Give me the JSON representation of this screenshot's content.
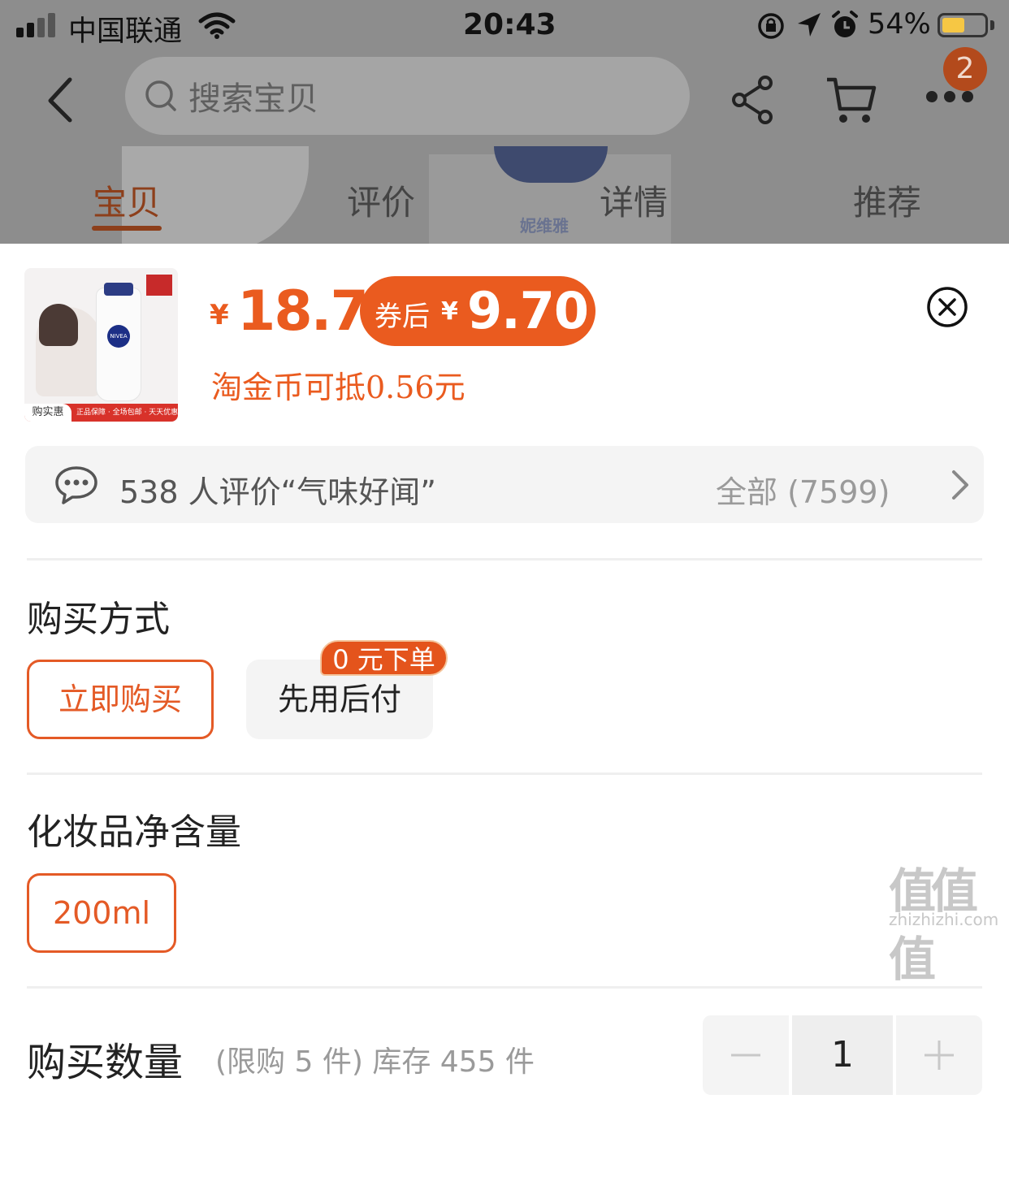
{
  "status_bar": {
    "carrier": "中国联通",
    "time": "20:43",
    "battery_percent": "54%",
    "battery_level": 0.54
  },
  "header": {
    "search_placeholder": "搜索宝贝",
    "message_badge": "2",
    "icons": [
      "back-icon",
      "search-icon",
      "share-icon",
      "cart-icon",
      "more-icon"
    ]
  },
  "background": {
    "brand_text": "妮维雅"
  },
  "tabs": [
    {
      "label": "宝贝",
      "active": true
    },
    {
      "label": "评价",
      "active": false
    },
    {
      "label": "详情",
      "active": false
    },
    {
      "label": "推荐",
      "active": false
    }
  ],
  "product": {
    "thumb_logo": "NIVEA",
    "thumb_footer_badge": "购实惠",
    "thumb_footer_text": "正品保障 · 全场包邮 · 天天优惠",
    "price_currency": "¥",
    "price": "18.7",
    "coupon_label": "券后",
    "coupon_currency": "¥",
    "coupon_price": "9.70",
    "coin_text": "淘金币可抵0.56元"
  },
  "review": {
    "text": "538 人评价“气味好闻”",
    "all_label": "全部 (7599)"
  },
  "purchase_method": {
    "title": "购买方式",
    "options": [
      {
        "label": "立即购买",
        "selected": true
      },
      {
        "label": "先用后付",
        "selected": false
      }
    ],
    "promo_tag": "0 元下单"
  },
  "volume": {
    "title": "化妆品净含量",
    "options": [
      {
        "label": "200ml",
        "selected": true
      }
    ]
  },
  "quantity": {
    "title": "购买数量",
    "info": "(限购 5 件) 库存 455 件",
    "value": "1"
  },
  "watermark": {
    "main": "值值值",
    "sub": "zhizhizhi.com"
  },
  "colors": {
    "accent": "#EA5B1F",
    "selected_border": "#E45A26",
    "promo_tag": "#E4541C",
    "battery": "#F6C744"
  }
}
